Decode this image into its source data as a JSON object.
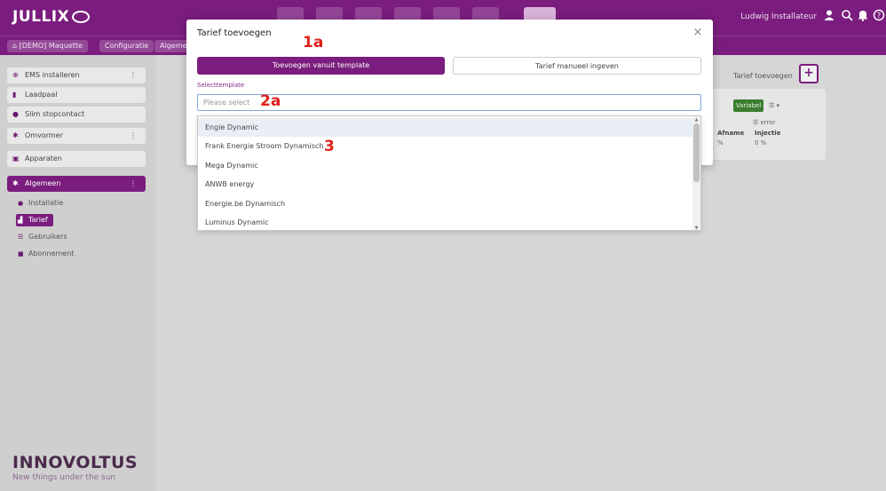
{
  "header": {
    "logo_text": "JULLIX",
    "user_name": "Ludwig Installateur"
  },
  "breadcrumb": [
    "[DEMO] Maquette",
    "Configuratie",
    "Algeme"
  ],
  "sidebar": {
    "items": [
      {
        "label": "EMS installeren",
        "more": "⋮"
      },
      {
        "label": "Laadpaal"
      },
      {
        "label": "Slim stopcontact"
      },
      {
        "label": "Omvormer",
        "more": "⋮"
      },
      {
        "label": "Apparaten"
      },
      {
        "label": "Algemeen",
        "more": "⋮"
      }
    ],
    "subitems": [
      {
        "label": "Installatie"
      },
      {
        "label": "Tarief"
      },
      {
        "label": "Gebruikers"
      },
      {
        "label": "Abonnement"
      }
    ],
    "brand_name": "INNOVOLTUS",
    "brand_tagline": "New things under the sun"
  },
  "background": {
    "add_tariff_label": "Tarief toevoegen",
    "add_symbol": "+",
    "badge": "Variabel",
    "dropdown_symbol": "☰ ▾",
    "small_text": "☰ error",
    "col_afname": "Afname",
    "col_injectie": "Injectie",
    "val_afname": "%",
    "val_injectie": "0 %"
  },
  "modal": {
    "title": "Tarief toevoegen",
    "close_symbol": "×",
    "tab_template": "Toevoegen vanuit template",
    "tab_manual": "Tarief manueel ingeven",
    "field_label": "Selecttemplate",
    "select_placeholder": "Please select"
  },
  "dropdown": {
    "options": [
      "Engie Dynamic",
      "Frank Energie Stroom Dynamisch",
      "Mega Dynamic",
      "ANWB energy",
      "Energie.be Dynamisch",
      "Luminus Dynamic"
    ],
    "scroll_up": "▲",
    "scroll_down": "▼"
  },
  "annotations": {
    "tabs": "1a",
    "select": "2a",
    "options": "3"
  },
  "colors": {
    "brand_purple": "#7a1d7e",
    "annotation_red": "#e0201a",
    "badge_green": "#3a7d2f"
  }
}
